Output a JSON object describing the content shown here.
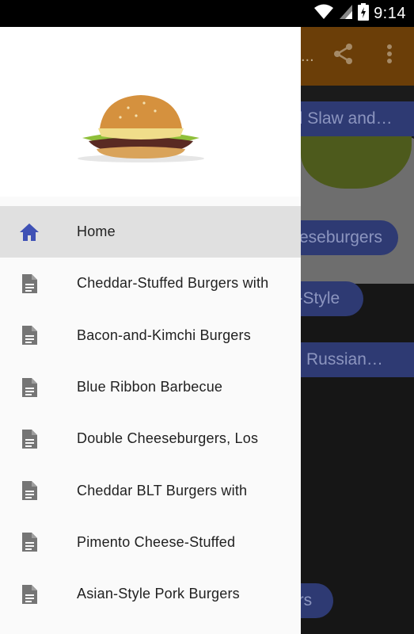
{
  "status_bar": {
    "time": "9:14"
  },
  "background": {
    "toolbar": {
      "title_fragment": "..."
    },
    "chips": [
      {
        "label": "ed Slaw and…"
      },
      {
        "label": "eseburgers"
      },
      {
        "label": "s-Style"
      },
      {
        "label": "Russian…"
      },
      {
        "label": "ers"
      }
    ]
  },
  "drawer": {
    "items": [
      {
        "label": "Home",
        "icon": "home-icon",
        "active": true
      },
      {
        "label": "Cheddar-Stuffed Burgers with",
        "icon": "document-icon"
      },
      {
        "label": "Bacon-and-Kimchi Burgers",
        "icon": "document-icon"
      },
      {
        "label": "Blue Ribbon Barbecue",
        "icon": "document-icon"
      },
      {
        "label": "Double Cheeseburgers, Los",
        "icon": "document-icon"
      },
      {
        "label": "Cheddar BLT Burgers with",
        "icon": "document-icon"
      },
      {
        "label": "Pimento Cheese-Stuffed",
        "icon": "document-icon"
      },
      {
        "label": "Asian-Style Pork Burgers",
        "icon": "document-icon"
      }
    ]
  },
  "colors": {
    "accent": "#3f51b5",
    "toolbar_dimmed": "#6b3e08",
    "chip_dimmed": "#2e3a73",
    "active_item_bg": "#e0e0e0"
  }
}
